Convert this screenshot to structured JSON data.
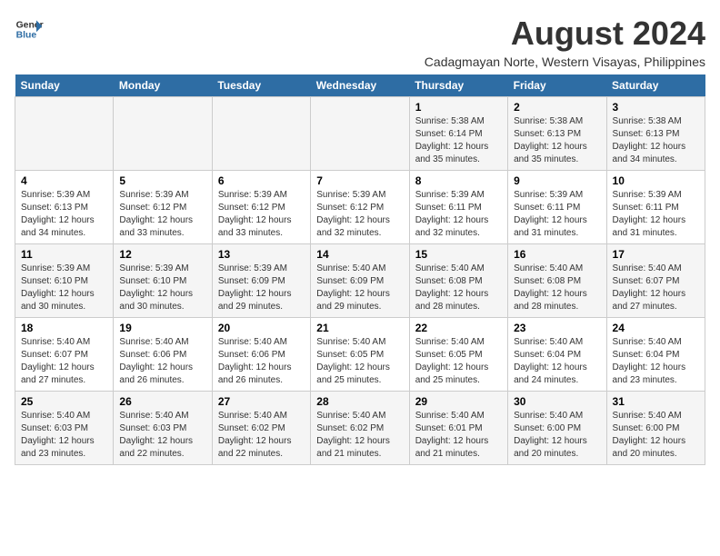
{
  "header": {
    "logo_line1": "General",
    "logo_line2": "Blue",
    "title": "August 2024",
    "subtitle": "Cadagmayan Norte, Western Visayas, Philippines"
  },
  "weekdays": [
    "Sunday",
    "Monday",
    "Tuesday",
    "Wednesday",
    "Thursday",
    "Friday",
    "Saturday"
  ],
  "weeks": [
    [
      {
        "day": "",
        "info": ""
      },
      {
        "day": "",
        "info": ""
      },
      {
        "day": "",
        "info": ""
      },
      {
        "day": "",
        "info": ""
      },
      {
        "day": "1",
        "info": "Sunrise: 5:38 AM\nSunset: 6:14 PM\nDaylight: 12 hours\nand 35 minutes."
      },
      {
        "day": "2",
        "info": "Sunrise: 5:38 AM\nSunset: 6:13 PM\nDaylight: 12 hours\nand 35 minutes."
      },
      {
        "day": "3",
        "info": "Sunrise: 5:38 AM\nSunset: 6:13 PM\nDaylight: 12 hours\nand 34 minutes."
      }
    ],
    [
      {
        "day": "4",
        "info": "Sunrise: 5:39 AM\nSunset: 6:13 PM\nDaylight: 12 hours\nand 34 minutes."
      },
      {
        "day": "5",
        "info": "Sunrise: 5:39 AM\nSunset: 6:12 PM\nDaylight: 12 hours\nand 33 minutes."
      },
      {
        "day": "6",
        "info": "Sunrise: 5:39 AM\nSunset: 6:12 PM\nDaylight: 12 hours\nand 33 minutes."
      },
      {
        "day": "7",
        "info": "Sunrise: 5:39 AM\nSunset: 6:12 PM\nDaylight: 12 hours\nand 32 minutes."
      },
      {
        "day": "8",
        "info": "Sunrise: 5:39 AM\nSunset: 6:11 PM\nDaylight: 12 hours\nand 32 minutes."
      },
      {
        "day": "9",
        "info": "Sunrise: 5:39 AM\nSunset: 6:11 PM\nDaylight: 12 hours\nand 31 minutes."
      },
      {
        "day": "10",
        "info": "Sunrise: 5:39 AM\nSunset: 6:11 PM\nDaylight: 12 hours\nand 31 minutes."
      }
    ],
    [
      {
        "day": "11",
        "info": "Sunrise: 5:39 AM\nSunset: 6:10 PM\nDaylight: 12 hours\nand 30 minutes."
      },
      {
        "day": "12",
        "info": "Sunrise: 5:39 AM\nSunset: 6:10 PM\nDaylight: 12 hours\nand 30 minutes."
      },
      {
        "day": "13",
        "info": "Sunrise: 5:39 AM\nSunset: 6:09 PM\nDaylight: 12 hours\nand 29 minutes."
      },
      {
        "day": "14",
        "info": "Sunrise: 5:40 AM\nSunset: 6:09 PM\nDaylight: 12 hours\nand 29 minutes."
      },
      {
        "day": "15",
        "info": "Sunrise: 5:40 AM\nSunset: 6:08 PM\nDaylight: 12 hours\nand 28 minutes."
      },
      {
        "day": "16",
        "info": "Sunrise: 5:40 AM\nSunset: 6:08 PM\nDaylight: 12 hours\nand 28 minutes."
      },
      {
        "day": "17",
        "info": "Sunrise: 5:40 AM\nSunset: 6:07 PM\nDaylight: 12 hours\nand 27 minutes."
      }
    ],
    [
      {
        "day": "18",
        "info": "Sunrise: 5:40 AM\nSunset: 6:07 PM\nDaylight: 12 hours\nand 27 minutes."
      },
      {
        "day": "19",
        "info": "Sunrise: 5:40 AM\nSunset: 6:06 PM\nDaylight: 12 hours\nand 26 minutes."
      },
      {
        "day": "20",
        "info": "Sunrise: 5:40 AM\nSunset: 6:06 PM\nDaylight: 12 hours\nand 26 minutes."
      },
      {
        "day": "21",
        "info": "Sunrise: 5:40 AM\nSunset: 6:05 PM\nDaylight: 12 hours\nand 25 minutes."
      },
      {
        "day": "22",
        "info": "Sunrise: 5:40 AM\nSunset: 6:05 PM\nDaylight: 12 hours\nand 25 minutes."
      },
      {
        "day": "23",
        "info": "Sunrise: 5:40 AM\nSunset: 6:04 PM\nDaylight: 12 hours\nand 24 minutes."
      },
      {
        "day": "24",
        "info": "Sunrise: 5:40 AM\nSunset: 6:04 PM\nDaylight: 12 hours\nand 23 minutes."
      }
    ],
    [
      {
        "day": "25",
        "info": "Sunrise: 5:40 AM\nSunset: 6:03 PM\nDaylight: 12 hours\nand 23 minutes."
      },
      {
        "day": "26",
        "info": "Sunrise: 5:40 AM\nSunset: 6:03 PM\nDaylight: 12 hours\nand 22 minutes."
      },
      {
        "day": "27",
        "info": "Sunrise: 5:40 AM\nSunset: 6:02 PM\nDaylight: 12 hours\nand 22 minutes."
      },
      {
        "day": "28",
        "info": "Sunrise: 5:40 AM\nSunset: 6:02 PM\nDaylight: 12 hours\nand 21 minutes."
      },
      {
        "day": "29",
        "info": "Sunrise: 5:40 AM\nSunset: 6:01 PM\nDaylight: 12 hours\nand 21 minutes."
      },
      {
        "day": "30",
        "info": "Sunrise: 5:40 AM\nSunset: 6:00 PM\nDaylight: 12 hours\nand 20 minutes."
      },
      {
        "day": "31",
        "info": "Sunrise: 5:40 AM\nSunset: 6:00 PM\nDaylight: 12 hours\nand 20 minutes."
      }
    ]
  ]
}
